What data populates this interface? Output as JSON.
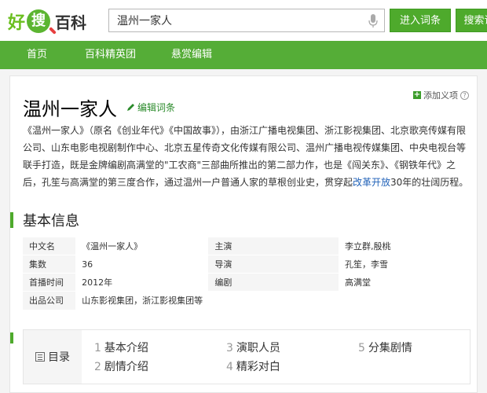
{
  "header": {
    "logo": {
      "hao": "好",
      "sou": "搜",
      "baike": "百科"
    },
    "search_value": "温州一家人",
    "enter_label": "进入词条",
    "search_label": "搜索词"
  },
  "nav": {
    "items": [
      "首页",
      "百科精英团",
      "悬赏编辑"
    ]
  },
  "page": {
    "title": "温州一家人",
    "edit_label": "编辑词条",
    "add_label": "添加义项",
    "help": "?"
  },
  "summary": {
    "p1": "《温州一家人》（原名《创业年代》《中国故事》），由浙江广播电视集团、浙江影视集团、北京歌亮传媒有限公司、山东电影电视剧制作中心、北京五星传奇文化传媒有限公司、温州广播电视传媒集团、中央电视台等联手打造，既是金牌编剧高满堂的\"工农商\"三部曲所推出的第二部力作，也是《闯关东》、《钢铁年代》之后，孔笙与高满堂的第三度合作，通过温州一户普通人家的草根创业史，贯穿起",
    "link": "改革开放",
    "p2": "30年的壮阔历程。"
  },
  "basic_info": {
    "section_title": "基本信息",
    "rows": [
      {
        "k1": "中文名",
        "v1": "《温州一家人》",
        "k2": "主演",
        "v2": "李立群,殷桃"
      },
      {
        "k1": "集数",
        "v1": "36",
        "k2": "导演",
        "v2": "孔笙，李雪"
      },
      {
        "k1": "首播时间",
        "v1": "2012年",
        "k2": "编剧",
        "v2": "高满堂"
      },
      {
        "k1": "出品公司",
        "v1": "山东影视集团，浙江影视集团等",
        "k2": "",
        "v2": ""
      }
    ]
  },
  "toc": {
    "label": "目录",
    "items": [
      {
        "num": "1",
        "text": "基本介绍"
      },
      {
        "num": "2",
        "text": "剧情介绍"
      },
      {
        "num": "3",
        "text": "演职人员"
      },
      {
        "num": "4",
        "text": "精彩对白"
      },
      {
        "num": "5",
        "text": "分集剧情"
      }
    ]
  },
  "colors": {
    "brand_green": "#55ad37",
    "link_blue": "#2162b8"
  }
}
